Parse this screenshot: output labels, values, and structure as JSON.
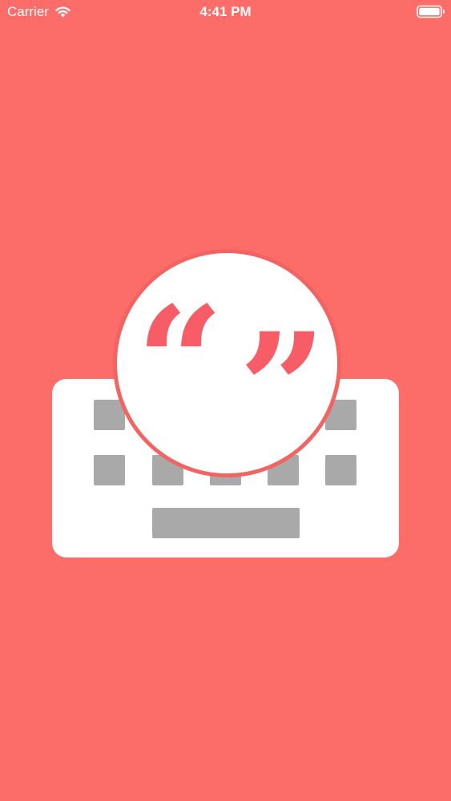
{
  "status_bar": {
    "carrier": "Carrier",
    "time": "4:41 PM",
    "wifi_icon": "wifi-icon",
    "battery_icon": "battery-icon"
  },
  "splash": {
    "background_color": "#fc6c68",
    "icons": [
      "keyboard-icon",
      "quote-bubble-icon"
    ],
    "quote_open": "“",
    "quote_close": "”",
    "accent_color": "#f65d66",
    "key_color": "#a9a9a9"
  }
}
